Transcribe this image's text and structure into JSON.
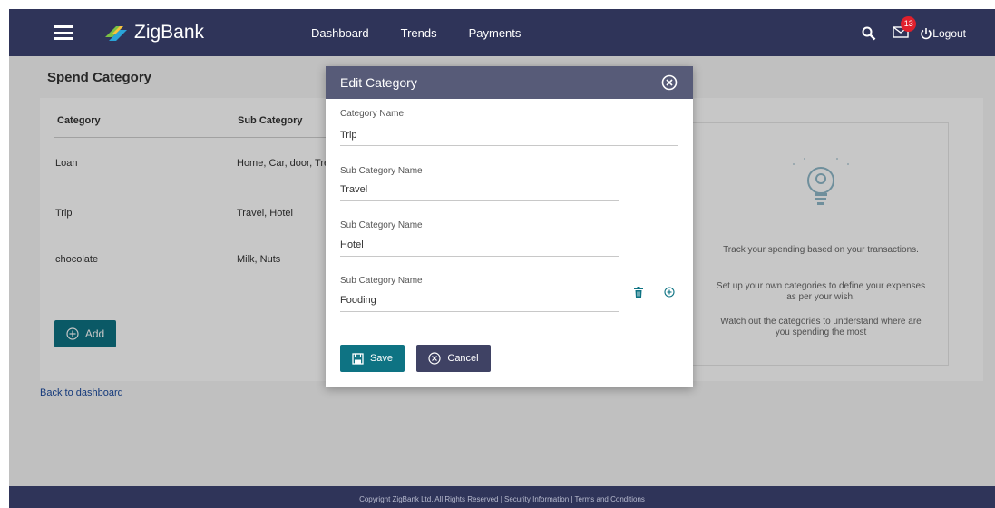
{
  "header": {
    "brand": "ZigBank",
    "nav": [
      "Dashboard",
      "Trends",
      "Payments"
    ],
    "notification_count": "13",
    "logout_label": "Logout"
  },
  "page": {
    "title": "Spend Category",
    "columns": [
      "Category",
      "Sub Category"
    ],
    "rows": [
      {
        "category": "Loan",
        "sub": "Home, Car, door, Tre"
      },
      {
        "category": "Trip",
        "sub": "Travel, Hotel"
      },
      {
        "category": "chocolate",
        "sub": "Milk, Nuts"
      }
    ],
    "add_label": "Add",
    "back_link": "Back to dashboard"
  },
  "info_panel": {
    "texts": [
      "Track your spending based on your transactions.",
      "Set up your own categories to define your expenses as per your wish.",
      "Watch out the categories to understand where are you spending the most"
    ]
  },
  "modal": {
    "title": "Edit Category",
    "category_label": "Category Name",
    "category_value": "Trip",
    "subcategories": [
      {
        "label": "Sub Category Name",
        "value": "Travel"
      },
      {
        "label": "Sub Category Name",
        "value": "Hotel"
      },
      {
        "label": "Sub Category Name",
        "value": "Fooding"
      }
    ],
    "save_label": "Save",
    "cancel_label": "Cancel"
  },
  "footer": {
    "text": "Copyright ZigBank Ltd. All Rights Reserved | Security Information | Terms and Conditions"
  },
  "colors": {
    "header_bg": "#2f3459",
    "primary_button": "#0e7383",
    "secondary_button": "#3f4264",
    "modal_header": "#575b78",
    "badge": "#e0202c"
  }
}
